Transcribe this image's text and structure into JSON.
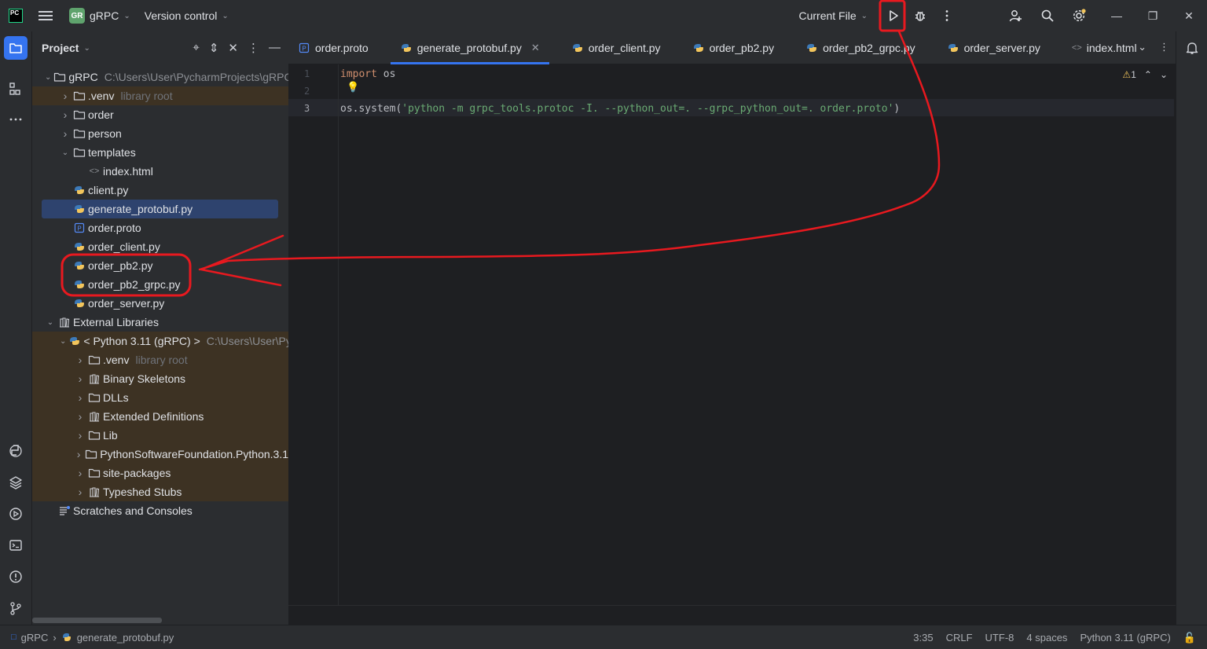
{
  "titlebar": {
    "logo": "PC",
    "project_badge": "GR",
    "project_name": "gRPC",
    "vcs": "Version control",
    "run_config": "Current File",
    "icons": [
      "main-menu-icon",
      "run-icon",
      "debug-icon",
      "more-icon",
      "add-user-icon",
      "search-icon",
      "settings-icon",
      "minimize-icon",
      "restore-icon",
      "close-icon"
    ]
  },
  "project_panel": {
    "title": "Project",
    "tree": [
      {
        "name": "gRPC",
        "path": "C:\\Users\\User\\PycharmProjects\\gRPC",
        "type": "folder",
        "expanded": true,
        "indent": 0
      },
      {
        "name": ".venv",
        "hint": "library root",
        "type": "folder",
        "expanded": false,
        "indent": 1,
        "excluded": true
      },
      {
        "name": "order",
        "type": "folder",
        "expanded": false,
        "indent": 1
      },
      {
        "name": "person",
        "type": "folder",
        "expanded": false,
        "indent": 1
      },
      {
        "name": "templates",
        "type": "folder",
        "expanded": true,
        "indent": 1
      },
      {
        "name": "index.html",
        "type": "html",
        "indent": 2
      },
      {
        "name": "client.py",
        "type": "python",
        "indent": 1
      },
      {
        "name": "generate_protobuf.py",
        "type": "python",
        "indent": 1,
        "selected": true
      },
      {
        "name": "order.proto",
        "type": "proto",
        "indent": 1
      },
      {
        "name": "order_client.py",
        "type": "python",
        "indent": 1
      },
      {
        "name": "order_pb2.py",
        "type": "python",
        "indent": 1
      },
      {
        "name": "order_pb2_grpc.py",
        "type": "python",
        "indent": 1
      },
      {
        "name": "order_server.py",
        "type": "python",
        "indent": 1
      },
      {
        "name": "External Libraries",
        "type": "library",
        "expanded": true,
        "indent": 0
      },
      {
        "name": "< Python 3.11 (gRPC) >",
        "path": "C:\\Users\\User\\Py",
        "type": "python",
        "expanded": true,
        "indent": 1,
        "excluded": true
      },
      {
        "name": ".venv",
        "hint": "library root",
        "type": "folder",
        "expanded": false,
        "indent": 2,
        "excluded": true
      },
      {
        "name": "Binary Skeletons",
        "type": "library",
        "expanded": false,
        "indent": 2,
        "excluded": true
      },
      {
        "name": "DLLs",
        "type": "folder",
        "expanded": false,
        "indent": 2,
        "excluded": true
      },
      {
        "name": "Extended Definitions",
        "type": "library",
        "expanded": false,
        "indent": 2,
        "excluded": true
      },
      {
        "name": "Lib",
        "type": "folder",
        "expanded": false,
        "indent": 2,
        "excluded": true
      },
      {
        "name": "PythonSoftwareFoundation.Python.3.1",
        "type": "folder",
        "expanded": false,
        "indent": 2,
        "excluded": true
      },
      {
        "name": "site-packages",
        "type": "folder",
        "expanded": false,
        "indent": 2,
        "excluded": true
      },
      {
        "name": "Typeshed Stubs",
        "type": "library",
        "expanded": false,
        "indent": 2,
        "excluded": true
      },
      {
        "name": "Scratches and Consoles",
        "type": "scratch",
        "indent": 0
      }
    ]
  },
  "tabs": [
    {
      "label": "order.proto",
      "type": "proto"
    },
    {
      "label": "generate_protobuf.py",
      "type": "python",
      "active": true
    },
    {
      "label": "order_client.py",
      "type": "python"
    },
    {
      "label": "order_pb2.py",
      "type": "python"
    },
    {
      "label": "order_pb2_grpc.py",
      "type": "python"
    },
    {
      "label": "order_server.py",
      "type": "python"
    },
    {
      "label": "index.html",
      "type": "html"
    }
  ],
  "editor": {
    "line_numbers": [
      "1",
      "2",
      "3"
    ],
    "line1_kw": "import",
    "line1_rest": " os",
    "line3_pre": "os.system(",
    "line3_str": "'python -m grpc_tools.protoc -I. --python_out=. --grpc_python_out=. order.proto'",
    "line3_post": ")",
    "warnings": "1"
  },
  "statusbar": {
    "breadcrumb_project": "gRPC",
    "breadcrumb_file": "generate_protobuf.py",
    "position": "3:35",
    "line_sep": "CRLF",
    "encoding": "UTF-8",
    "indent": "4 spaces",
    "interpreter": "Python 3.11 (gRPC)"
  },
  "colors": {
    "accent": "#3574f0",
    "annotation_red": "#e8191f",
    "string": "#6aab73",
    "keyword": "#cf8e6d"
  }
}
